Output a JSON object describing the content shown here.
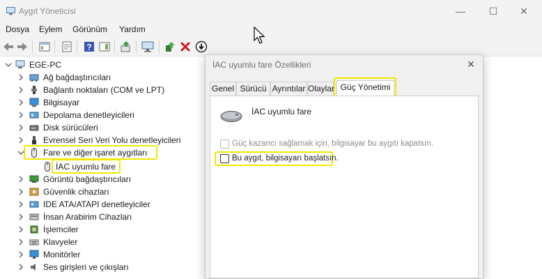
{
  "window": {
    "title": "Aygıt Yöneticisi",
    "minimize_glyph": "—",
    "maximize_glyph": "☐",
    "close_glyph": "✕"
  },
  "menu": [
    "Dosya",
    "Eylem",
    "Görünüm",
    "Yardım"
  ],
  "toolbar": {
    "icons": [
      "back-arrow-icon",
      "forward-arrow-icon",
      "show-hide-tree-icon",
      "properties-sheet-icon",
      "help-icon",
      "action-pane-icon",
      "scan-hardware-icon",
      "monitor-icon",
      "update-driver-icon",
      "uninstall-x-icon",
      "disable-device-icon"
    ]
  },
  "tree": {
    "root": "EGE-PC",
    "items": [
      {
        "label": "Ağ bağdaştırıcıları",
        "icon": "network-adapter-icon",
        "expanded": false
      },
      {
        "label": "Bağlantı noktaları (COM ve LPT)",
        "icon": "port-icon",
        "expanded": false
      },
      {
        "label": "Bilgisayar",
        "icon": "computer-icon",
        "expanded": false
      },
      {
        "label": "Depolama denetleyicileri",
        "icon": "storage-controller-icon",
        "expanded": false
      },
      {
        "label": "Disk sürücüleri",
        "icon": "disk-drive-icon",
        "expanded": false
      },
      {
        "label": "Evrensel Seri Veri Yolu denetleyicileri",
        "icon": "usb-icon",
        "expanded": false
      },
      {
        "label": "Fare ve diğer işaret aygıtları",
        "icon": "mouse-icon",
        "expanded": true,
        "children": [
          {
            "label": "İAC uyumlu fare",
            "icon": "mouse-icon"
          }
        ]
      },
      {
        "label": "Görüntü bağdaştırıcıları",
        "icon": "display-adapter-icon",
        "expanded": false
      },
      {
        "label": "Güvenlik cihazları",
        "icon": "security-device-icon",
        "expanded": false
      },
      {
        "label": "IDE ATA/ATAPI denetleyiciler",
        "icon": "ide-controller-icon",
        "expanded": false
      },
      {
        "label": "İnsan Arabirim Cihazları",
        "icon": "hid-icon",
        "expanded": false
      },
      {
        "label": "İşlemciler",
        "icon": "processor-icon",
        "expanded": false
      },
      {
        "label": "Klavyeler",
        "icon": "keyboard-icon",
        "expanded": false
      },
      {
        "label": "Monitörler",
        "icon": "monitor-icon",
        "expanded": false
      },
      {
        "label": "Ses girişleri ve çıkışları",
        "icon": "audio-icon",
        "expanded": false
      }
    ]
  },
  "dialog": {
    "title": "İAC uyumlu fare Özellikleri",
    "tabs": [
      "Genel",
      "Sürücü",
      "Ayrıntılar",
      "Olaylar",
      "Güç Yönetimi"
    ],
    "active_tab": "Güç Yönetimi",
    "device_name": "İAC uyumlu fare",
    "options": [
      {
        "label": "Güç kazancı sağlamak için, bilgisayar bu aygıtı kapatsın.",
        "checked": false,
        "enabled": false
      },
      {
        "label": "Bu aygıt, bilgisayarı başlatsın.",
        "checked": false,
        "enabled": true
      }
    ]
  },
  "colors": {
    "chrome": "#f3f3f3",
    "highlight": "#f0e800",
    "accent_blue": "#1a73c8"
  }
}
